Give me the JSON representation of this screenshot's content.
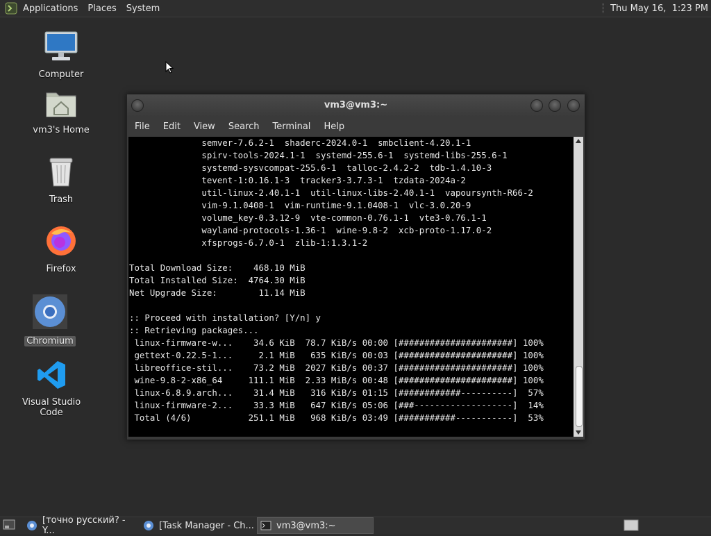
{
  "top_panel": {
    "menu": [
      "Applications",
      "Places",
      "System"
    ],
    "clock": "Thu May 16,  1:23 PM"
  },
  "desktop_icons": [
    {
      "label": "Computer"
    },
    {
      "label": "vm3's Home"
    },
    {
      "label": "Trash"
    },
    {
      "label": "Firefox"
    },
    {
      "label": "Chromium"
    },
    {
      "label": "Visual Studio Code"
    }
  ],
  "terminal": {
    "title": "vm3@vm3:~",
    "menu": [
      "File",
      "Edit",
      "View",
      "Search",
      "Terminal",
      "Help"
    ],
    "lines": [
      "              semver-7.6.2-1  shaderc-2024.0-1  smbclient-4.20.1-1",
      "              spirv-tools-2024.1-1  systemd-255.6-1  systemd-libs-255.6-1",
      "              systemd-sysvcompat-255.6-1  talloc-2.4.2-2  tdb-1.4.10-3",
      "              tevent-1:0.16.1-3  tracker3-3.7.3-1  tzdata-2024a-2",
      "              util-linux-2.40.1-1  util-linux-libs-2.40.1-1  vapoursynth-R66-2",
      "              vim-9.1.0408-1  vim-runtime-9.1.0408-1  vlc-3.0.20-9",
      "              volume_key-0.3.12-9  vte-common-0.76.1-1  vte3-0.76.1-1",
      "              wayland-protocols-1.36-1  wine-9.8-2  xcb-proto-1.17.0-2",
      "              xfsprogs-6.7.0-1  zlib-1:1.3.1-2",
      "",
      "Total Download Size:    468.10 MiB",
      "Total Installed Size:  4764.30 MiB",
      "Net Upgrade Size:        11.14 MiB",
      "",
      ":: Proceed with installation? [Y/n] y",
      ":: Retrieving packages...",
      " linux-firmware-w...    34.6 KiB  78.7 KiB/s 00:00 [######################] 100%",
      " gettext-0.22.5-1...     2.1 MiB   635 KiB/s 00:03 [######################] 100%",
      " libreoffice-stil...    73.2 MiB  2027 KiB/s 00:37 [######################] 100%",
      " wine-9.8-2-x86_64     111.1 MiB  2.33 MiB/s 00:48 [######################] 100%",
      " linux-6.8.9.arch...    31.4 MiB   316 KiB/s 01:15 [############----------]  57%",
      " linux-firmware-2...    33.3 MiB   647 KiB/s 05:06 [###-------------------]  14%",
      " Total (4/6)           251.1 MiB   968 KiB/s 03:49 [###########-----------]  53%"
    ]
  },
  "taskbar": [
    {
      "label": "[точно русский? - Y..."
    },
    {
      "label": "[Task Manager - Ch..."
    },
    {
      "label": "vm3@vm3:~"
    }
  ],
  "colors": {
    "panel": "#2e2e2e",
    "desktop": "#2b2b2b",
    "terminal_bg": "#000000",
    "terminal_fg": "#e8e8e8"
  }
}
